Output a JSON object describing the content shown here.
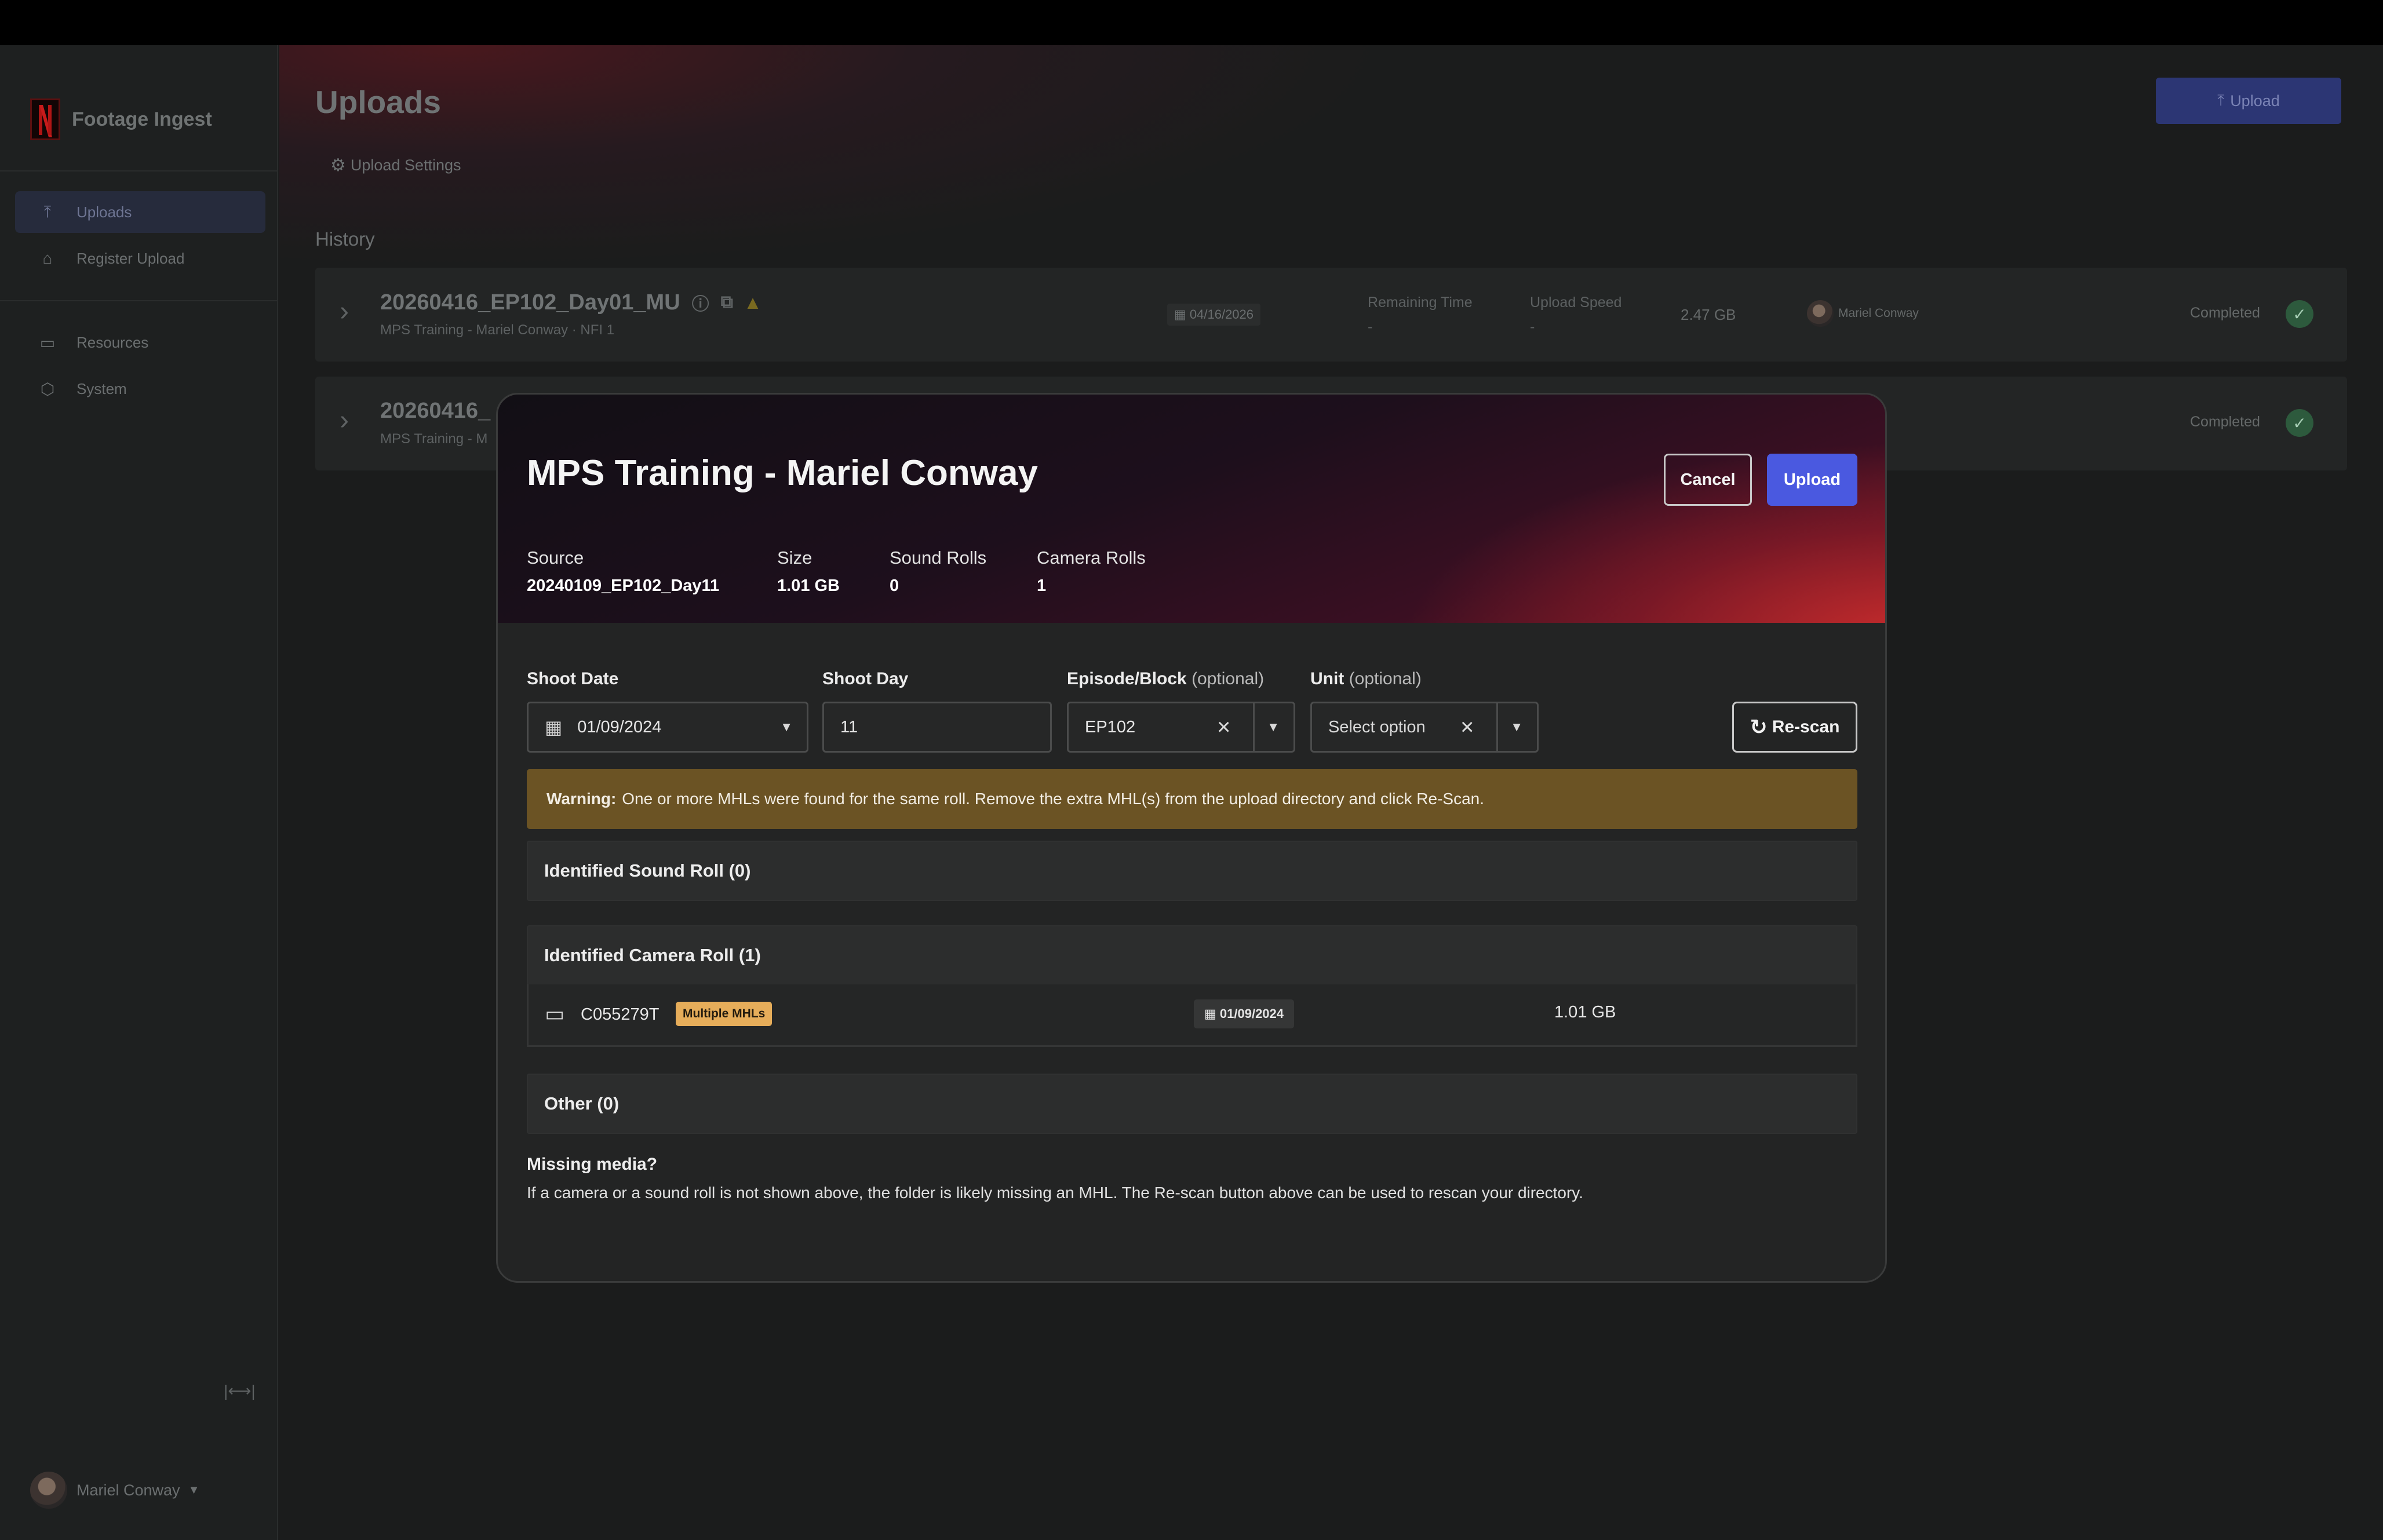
{
  "app": {
    "name": "Footage Ingest"
  },
  "sidebar": {
    "items": [
      {
        "label": "Uploads",
        "icon": "upload-icon",
        "active": true
      },
      {
        "label": "Register Upload",
        "icon": "home-icon",
        "active": false
      },
      {
        "label": "Resources",
        "icon": "book-icon",
        "active": false
      },
      {
        "label": "System",
        "icon": "cube-icon",
        "active": false
      }
    ],
    "collapse_icon": "|⟷|",
    "user": {
      "name": "Mariel Conway"
    }
  },
  "main": {
    "title": "Uploads",
    "upload_button": "Upload",
    "settings_label": "Upload Settings",
    "history_label": "History",
    "history": [
      {
        "name": "20260416_EP102_Day01_MU",
        "subtitle": "MPS Training - Mariel Conway · NFI 1",
        "date": "04/16/2026",
        "remaining_label": "Remaining Time",
        "remaining_value": "-",
        "speed_label": "Upload Speed",
        "speed_value": "-",
        "size": "2.47 GB",
        "owner": "Mariel Conway",
        "status": "Completed"
      },
      {
        "name": "20260416_",
        "subtitle": "MPS Training - M",
        "status": "Completed"
      }
    ]
  },
  "modal": {
    "title": "MPS Training - Mariel Conway",
    "cancel_label": "Cancel",
    "upload_label": "Upload",
    "meta": [
      {
        "key": "Source",
        "value": "20240109_EP102_Day11"
      },
      {
        "key": "Size",
        "value": "1.01 GB"
      },
      {
        "key": "Sound Rolls",
        "value": "0"
      },
      {
        "key": "Camera Rolls",
        "value": "1"
      }
    ],
    "form": {
      "shoot_date_label": "Shoot Date",
      "shoot_date_value": "01/09/2024",
      "shoot_day_label": "Shoot Day",
      "shoot_day_value": "11",
      "episode_label": "Episode/Block",
      "episode_optional": "(optional)",
      "episode_value": "EP102",
      "unit_label": "Unit",
      "unit_optional": "(optional)",
      "unit_placeholder": "Select option",
      "rescan_label": "Re-scan"
    },
    "warning": {
      "prefix": "Warning:",
      "text": "One or more MHLs were found for the same roll. Remove the extra MHL(s) from the upload directory and click Re-Scan."
    },
    "sections": {
      "sound": "Identified Sound Roll (0)",
      "camera": "Identified Camera Roll (1)",
      "other": "Other (0)"
    },
    "camera_rolls": [
      {
        "name": "C055279T",
        "badge": "Multiple MHLs",
        "date": "01/09/2024",
        "size": "1.01 GB"
      }
    ],
    "missing": {
      "heading": "Missing media?",
      "text": "If a camera or a sound roll is not shown above, the folder is likely missing an MHL. The Re-scan button above can be used to rescan your directory."
    }
  },
  "colors": {
    "accent": "#4a59e0",
    "warning_bg": "#6b5324",
    "badge_bg": "#e6ad5a",
    "success": "#2d5a3d"
  }
}
